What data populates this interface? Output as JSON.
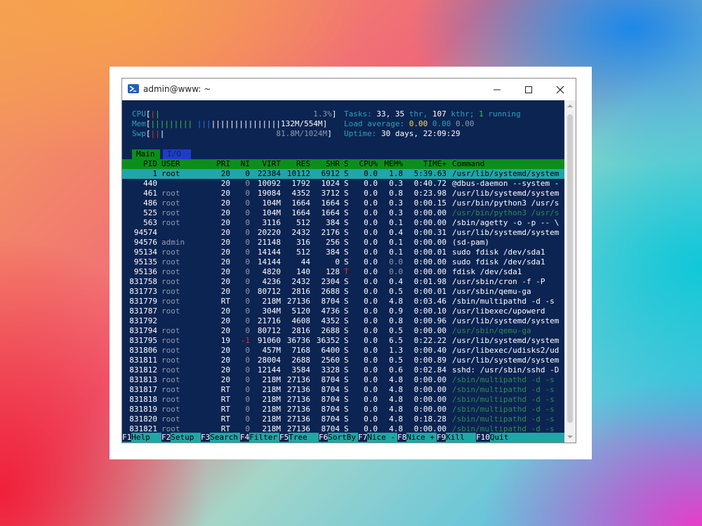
{
  "window": {
    "title": "admin@www: ~"
  },
  "meters": {
    "cpu_label": "CPU",
    "cpu_value": "1.3%",
    "mem_label": "Mem",
    "mem_value": "132M/554M",
    "swp_label": "Swp",
    "swp_value": "81.8M/1024M"
  },
  "summary": {
    "tasks_label": "Tasks:",
    "tasks_count": "33,",
    "threads": "35",
    "threads_label": "thr,",
    "kthreads": "107",
    "kthr_label": "kthr;",
    "running": "1",
    "running_label": "running",
    "load_label": "Load average:",
    "load1": "0.00",
    "load5": "0.00",
    "load15": "0.00",
    "uptime_label": "Uptime:",
    "uptime": "30 days, 22:09:29"
  },
  "tabs": [
    {
      "label": "Main"
    },
    {
      "label": "I/O"
    }
  ],
  "columns": {
    "pid": "PID",
    "user": "USER",
    "pri": "PRI",
    "ni": "NI",
    "virt": "VIRT",
    "res": "RES",
    "shr": "SHR",
    "s": "S",
    "cpu": "CPU%",
    "mem": "MEM%",
    "time": "TIME+",
    "cmd": "Command"
  },
  "processes": [
    {
      "pid": "1",
      "user": "root",
      "pri": "20",
      "ni": "0",
      "virt": "22384",
      "res": "10112",
      "shr": "6912",
      "s": "S",
      "cpu": "0.0",
      "mem": "1.8",
      "time": "5:39.63",
      "cmd": "/usr/lib/systemd/system"
    },
    {
      "pid": "440",
      "user": "",
      "pri": "20",
      "ni": "0",
      "virt": "10092",
      "res": "1792",
      "shr": "1024",
      "s": "S",
      "cpu": "0.0",
      "mem": "0.3",
      "time": "0:40.72",
      "cmd": "@dbus-daemon --system -"
    },
    {
      "pid": "461",
      "user": "root",
      "pri": "20",
      "ni": "0",
      "virt": "19084",
      "res": "4352",
      "shr": "3712",
      "s": "S",
      "cpu": "0.0",
      "mem": "0.8",
      "time": "0:23.98",
      "cmd": "/usr/lib/systemd/system"
    },
    {
      "pid": "486",
      "user": "root",
      "pri": "20",
      "ni": "0",
      "virt": "104M",
      "res": "1664",
      "shr": "1664",
      "s": "S",
      "cpu": "0.0",
      "mem": "0.3",
      "time": "0:00.15",
      "cmd": "/usr/bin/python3 /usr/s"
    },
    {
      "pid": "525",
      "user": "root",
      "pri": "20",
      "ni": "0",
      "virt": "104M",
      "res": "1664",
      "shr": "1664",
      "s": "S",
      "cpu": "0.0",
      "mem": "0.3",
      "time": "0:00.00",
      "cmd": "/usr/bin/python3 /usr/s"
    },
    {
      "pid": "563",
      "user": "root",
      "pri": "20",
      "ni": "0",
      "virt": "3116",
      "res": "512",
      "shr": "384",
      "s": "S",
      "cpu": "0.0",
      "mem": "0.1",
      "time": "0:00.00",
      "cmd": "/sbin/agetty -o -p -- \\"
    },
    {
      "pid": "94574",
      "user": "",
      "pri": "20",
      "ni": "0",
      "virt": "20220",
      "res": "2432",
      "shr": "2176",
      "s": "S",
      "cpu": "0.0",
      "mem": "0.4",
      "time": "0:00.31",
      "cmd": "/usr/lib/systemd/system"
    },
    {
      "pid": "94576",
      "user": "admin",
      "pri": "20",
      "ni": "0",
      "virt": "21148",
      "res": "316",
      "shr": "256",
      "s": "S",
      "cpu": "0.0",
      "mem": "0.1",
      "time": "0:00.00",
      "cmd": "(sd-pam)"
    },
    {
      "pid": "95134",
      "user": "root",
      "pri": "20",
      "ni": "0",
      "virt": "14144",
      "res": "512",
      "shr": "384",
      "s": "S",
      "cpu": "0.0",
      "mem": "0.1",
      "time": "0:00.01",
      "cmd": "sudo fdisk /dev/sda1"
    },
    {
      "pid": "95135",
      "user": "root",
      "pri": "20",
      "ni": "0",
      "virt": "14144",
      "res": "44",
      "shr": "0",
      "s": "S",
      "cpu": "0.0",
      "mem": "0.0",
      "time": "0:00.00",
      "cmd": "sudo fdisk /dev/sda1"
    },
    {
      "pid": "95136",
      "user": "root",
      "pri": "20",
      "ni": "0",
      "virt": "4820",
      "res": "140",
      "shr": "128",
      "s": "T",
      "cpu": "0.0",
      "mem": "0.0",
      "time": "0:00.00",
      "cmd": "fdisk /dev/sda1"
    },
    {
      "pid": "831758",
      "user": "root",
      "pri": "20",
      "ni": "0",
      "virt": "4236",
      "res": "2432",
      "shr": "2304",
      "s": "S",
      "cpu": "0.0",
      "mem": "0.4",
      "time": "0:01.98",
      "cmd": "/usr/sbin/cron -f -P"
    },
    {
      "pid": "831773",
      "user": "root",
      "pri": "20",
      "ni": "0",
      "virt": "80712",
      "res": "2816",
      "shr": "2688",
      "s": "S",
      "cpu": "0.0",
      "mem": "0.5",
      "time": "0:00.01",
      "cmd": "/usr/sbin/qemu-ga"
    },
    {
      "pid": "831779",
      "user": "root",
      "pri": "RT",
      "ni": "0",
      "virt": "218M",
      "res": "27136",
      "shr": "8704",
      "s": "S",
      "cpu": "0.0",
      "mem": "4.8",
      "time": "0:03.46",
      "cmd": "/sbin/multipathd -d -s"
    },
    {
      "pid": "831787",
      "user": "root",
      "pri": "20",
      "ni": "0",
      "virt": "304M",
      "res": "5120",
      "shr": "4736",
      "s": "S",
      "cpu": "0.0",
      "mem": "0.9",
      "time": "0:00.10",
      "cmd": "/usr/libexec/upowerd"
    },
    {
      "pid": "831792",
      "user": "",
      "pri": "20",
      "ni": "0",
      "virt": "21716",
      "res": "4608",
      "shr": "4352",
      "s": "S",
      "cpu": "0.0",
      "mem": "0.8",
      "time": "0:00.96",
      "cmd": "/usr/lib/systemd/system"
    },
    {
      "pid": "831794",
      "user": "root",
      "pri": "20",
      "ni": "0",
      "virt": "80712",
      "res": "2816",
      "shr": "2688",
      "s": "S",
      "cpu": "0.0",
      "mem": "0.5",
      "time": "0:00.00",
      "cmd": "/usr/sbin/qemu-ga"
    },
    {
      "pid": "831795",
      "user": "root",
      "pri": "19",
      "ni": "-1",
      "virt": "91060",
      "res": "36736",
      "shr": "36352",
      "s": "S",
      "cpu": "0.0",
      "mem": "6.5",
      "time": "0:22.22",
      "cmd": "/usr/lib/systemd/system"
    },
    {
      "pid": "831806",
      "user": "root",
      "pri": "20",
      "ni": "0",
      "virt": "457M",
      "res": "7168",
      "shr": "6400",
      "s": "S",
      "cpu": "0.0",
      "mem": "1.3",
      "time": "0:00.40",
      "cmd": "/usr/libexec/udisks2/ud"
    },
    {
      "pid": "831811",
      "user": "root",
      "pri": "20",
      "ni": "0",
      "virt": "28004",
      "res": "2688",
      "shr": "2560",
      "s": "S",
      "cpu": "0.0",
      "mem": "0.5",
      "time": "0:00.89",
      "cmd": "/usr/lib/systemd/system"
    },
    {
      "pid": "831812",
      "user": "root",
      "pri": "20",
      "ni": "0",
      "virt": "12144",
      "res": "3584",
      "shr": "3328",
      "s": "S",
      "cpu": "0.0",
      "mem": "0.6",
      "time": "0:02.84",
      "cmd": "sshd: /usr/sbin/sshd -D"
    },
    {
      "pid": "831813",
      "user": "root",
      "pri": "20",
      "ni": "0",
      "virt": "218M",
      "res": "27136",
      "shr": "8704",
      "s": "S",
      "cpu": "0.0",
      "mem": "4.8",
      "time": "0:00.00",
      "cmd": "/sbin/multipathd -d -s"
    },
    {
      "pid": "831817",
      "user": "root",
      "pri": "RT",
      "ni": "0",
      "virt": "218M",
      "res": "27136",
      "shr": "8704",
      "s": "S",
      "cpu": "0.0",
      "mem": "4.8",
      "time": "0:00.00",
      "cmd": "/sbin/multipathd -d -s"
    },
    {
      "pid": "831818",
      "user": "root",
      "pri": "RT",
      "ni": "0",
      "virt": "218M",
      "res": "27136",
      "shr": "8704",
      "s": "S",
      "cpu": "0.0",
      "mem": "4.8",
      "time": "0:00.00",
      "cmd": "/sbin/multipathd -d -s"
    },
    {
      "pid": "831819",
      "user": "root",
      "pri": "RT",
      "ni": "0",
      "virt": "218M",
      "res": "27136",
      "shr": "8704",
      "s": "S",
      "cpu": "0.0",
      "mem": "4.8",
      "time": "0:00.00",
      "cmd": "/sbin/multipathd -d -s"
    },
    {
      "pid": "831820",
      "user": "root",
      "pri": "RT",
      "ni": "0",
      "virt": "218M",
      "res": "27136",
      "shr": "8704",
      "s": "S",
      "cpu": "0.0",
      "mem": "4.8",
      "time": "0:18.28",
      "cmd": "/sbin/multipathd -d -s"
    },
    {
      "pid": "831821",
      "user": "root",
      "pri": "RT",
      "ni": "0",
      "virt": "218M",
      "res": "27136",
      "shr": "8704",
      "s": "S",
      "cpu": "0.0",
      "mem": "4.8",
      "time": "0:00.00",
      "cmd": "/sbin/multipathd -d -s"
    }
  ],
  "footer": [
    {
      "key": "F1",
      "label": "Help  "
    },
    {
      "key": "F2",
      "label": "Setup "
    },
    {
      "key": "F3",
      "label": "Search"
    },
    {
      "key": "F4",
      "label": "Filter"
    },
    {
      "key": "F5",
      "label": "Tree  "
    },
    {
      "key": "F6",
      "label": "SortBy"
    },
    {
      "key": "F7",
      "label": "Nice -"
    },
    {
      "key": "F8",
      "label": "Nice +"
    },
    {
      "key": "F9",
      "label": "Kill  "
    },
    {
      "key": "F10",
      "label": "Quit"
    }
  ],
  "colors": {
    "terminal_bg": "#0c2452",
    "header_green": "#0b8f1a",
    "selection_cyan": "#20a6a6"
  }
}
